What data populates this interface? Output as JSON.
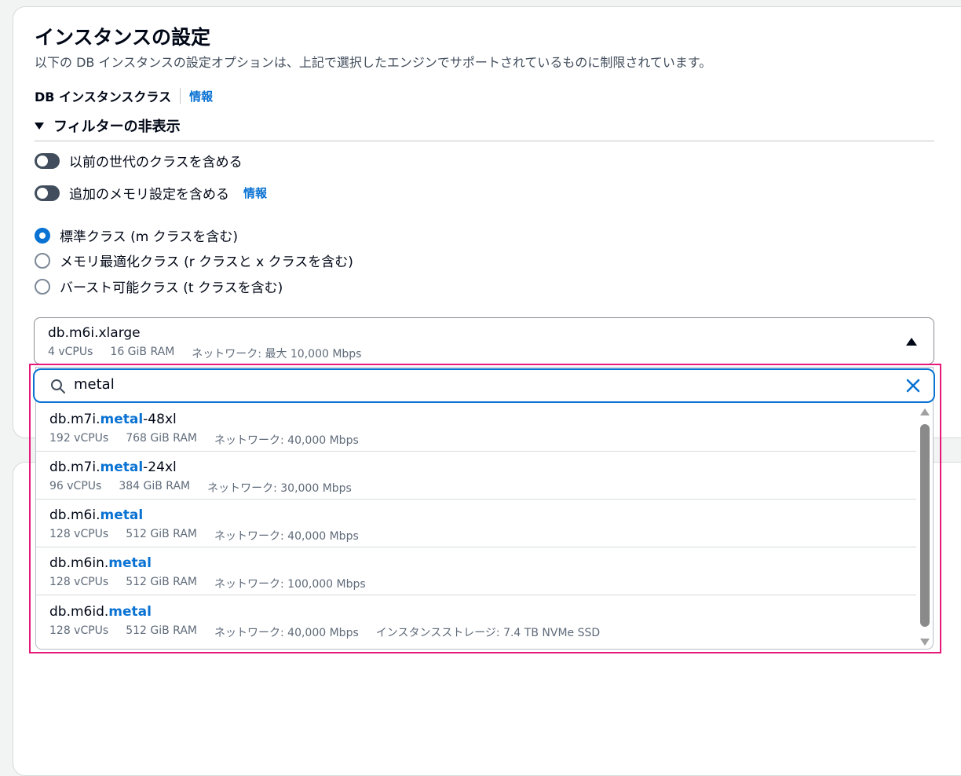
{
  "section": {
    "title": "インスタンスの設定",
    "description": "以下の DB インスタンスの設定オプションは、上記で選択したエンジンでサポートされているものに制限されています。"
  },
  "instance_class": {
    "label": "DB インスタンスクラス",
    "info_link": "情報",
    "filter_toggle": "フィルターの非表示",
    "toggles": [
      {
        "label": "以前の世代のクラスを含める",
        "checked": false
      },
      {
        "label": "追加のメモリ設定を含める",
        "checked": false,
        "info_link": "情報"
      }
    ],
    "radios": [
      {
        "label": "標準クラス (m クラスを含む)",
        "checked": true
      },
      {
        "label": "メモリ最適化クラス (r クラスと x クラスを含む)",
        "checked": false
      },
      {
        "label": "バースト可能クラス (t クラスを含む)",
        "checked": false
      }
    ],
    "selected": {
      "name": "db.m6i.xlarge",
      "vcpu": "4 vCPUs",
      "ram": "16 GiB RAM",
      "network": "ネットワーク: 最大 10,000 Mbps"
    }
  },
  "search": {
    "value": "metal"
  },
  "options": [
    {
      "prefix": "db.m7i.",
      "match": "metal",
      "suffix": "-48xl",
      "vcpu": "192 vCPUs",
      "ram": "768 GiB RAM",
      "network": "ネットワーク: 40,000 Mbps",
      "storage": ""
    },
    {
      "prefix": "db.m7i.",
      "match": "metal",
      "suffix": "-24xl",
      "vcpu": "96 vCPUs",
      "ram": "384 GiB RAM",
      "network": "ネットワーク: 30,000 Mbps",
      "storage": ""
    },
    {
      "prefix": "db.m6i.",
      "match": "metal",
      "suffix": "",
      "vcpu": "128 vCPUs",
      "ram": "512 GiB RAM",
      "network": "ネットワーク: 40,000 Mbps",
      "storage": ""
    },
    {
      "prefix": "db.m6in.",
      "match": "metal",
      "suffix": "",
      "vcpu": "128 vCPUs",
      "ram": "512 GiB RAM",
      "network": "ネットワーク: 100,000 Mbps",
      "storage": ""
    },
    {
      "prefix": "db.m6id.",
      "match": "metal",
      "suffix": "",
      "vcpu": "128 vCPUs",
      "ram": "512 GiB RAM",
      "network": "ネットワーク: 40,000 Mbps",
      "storage": "インスタンスストレージ: 7.4 TB NVMe SSD"
    }
  ],
  "colors": {
    "accent": "#0972d3",
    "highlight_border": "#e5197a",
    "toggle_off": "#414d5c"
  }
}
